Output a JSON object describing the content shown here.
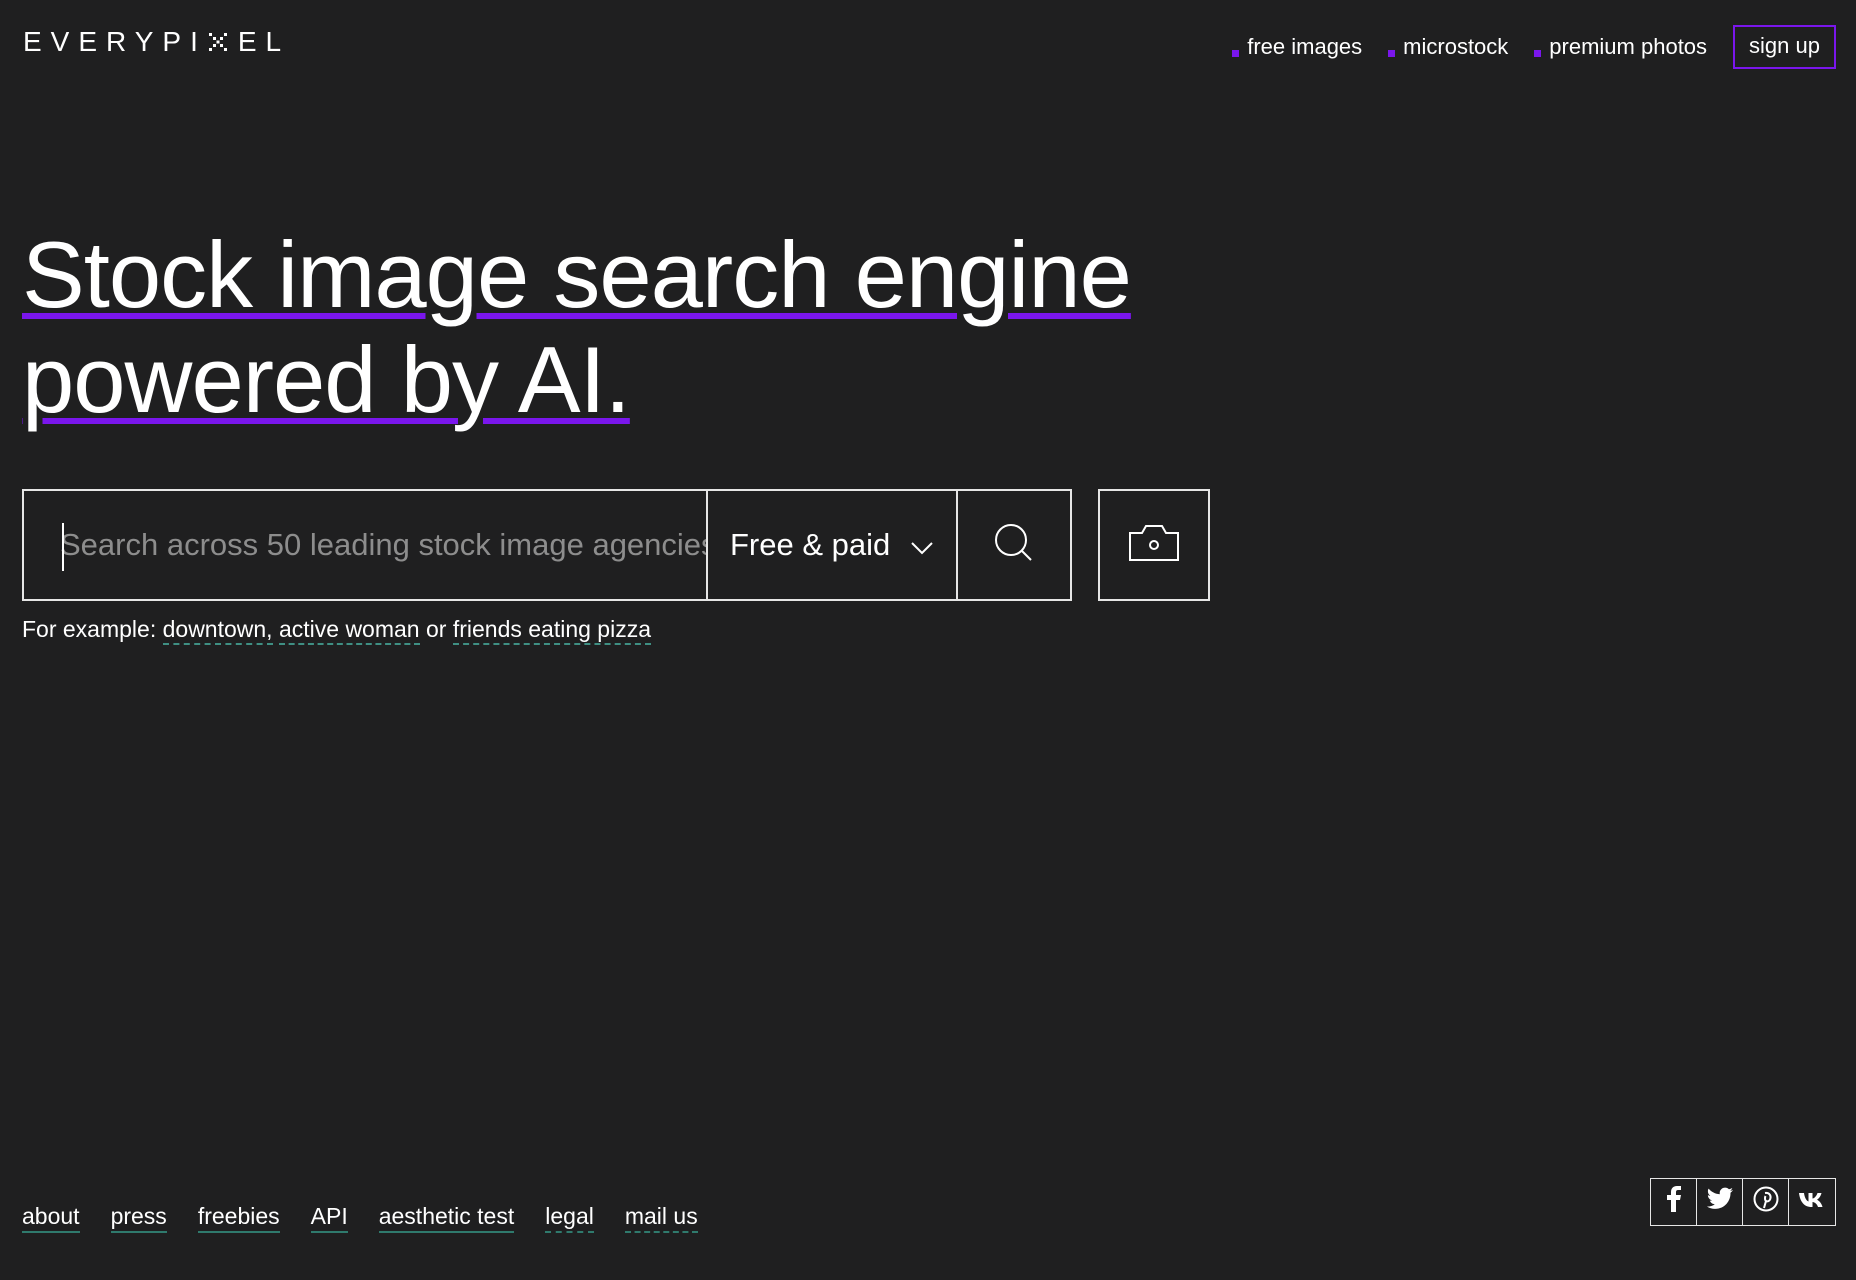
{
  "brand": {
    "logo_left": "EVERYPI",
    "logo_right": "EL"
  },
  "topnav": {
    "items": [
      {
        "label": "free images"
      },
      {
        "label": "microstock"
      },
      {
        "label": "premium photos"
      }
    ],
    "signup": "sign up"
  },
  "hero": {
    "line1": "Stock image search engine",
    "line2": "powered by AI."
  },
  "search": {
    "placeholder": "Search across 50 leading stock image agencies",
    "filter_value": "Free & paid"
  },
  "examples": {
    "prefix": "For example:",
    "items": [
      "downtown,",
      "active woman",
      "friends eating pizza"
    ],
    "separator": "or"
  },
  "footer": {
    "links": [
      "about",
      "press",
      "freebies",
      "API",
      "aesthetic test",
      "legal",
      "mail us"
    ]
  },
  "social": [
    "facebook-icon",
    "twitter-icon",
    "pinterest-icon",
    "vk-icon"
  ],
  "colors": {
    "background": "#1f1f20",
    "accent": "#7a16ec",
    "link_underline": "#2f7a6d"
  }
}
